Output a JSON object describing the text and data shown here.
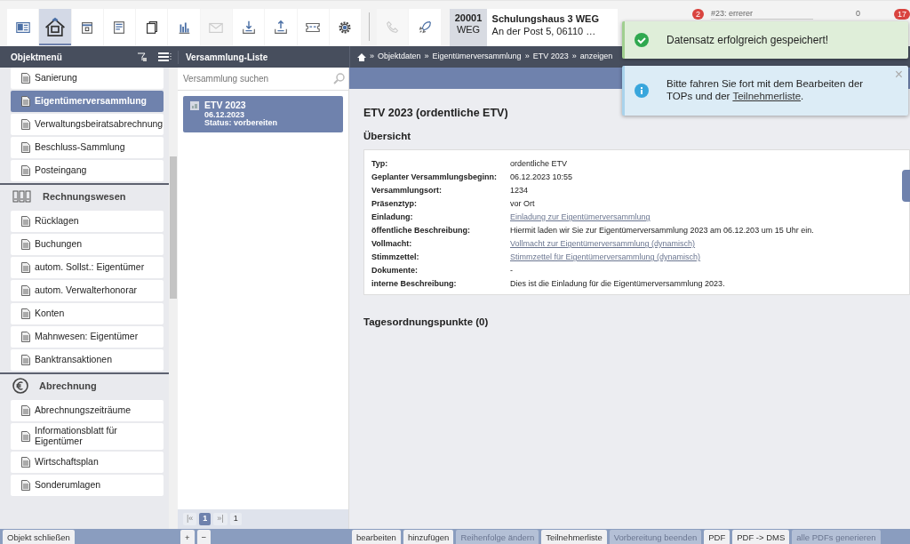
{
  "toolbar": {
    "buttons": [
      {
        "kind": "card",
        "selected": false,
        "disabled": false
      },
      {
        "kind": "house",
        "selected": true,
        "disabled": false
      },
      {
        "kind": "calendar",
        "selected": false,
        "disabled": false
      },
      {
        "kind": "form",
        "selected": false,
        "disabled": false
      },
      {
        "kind": "copies",
        "selected": false,
        "disabled": false
      },
      {
        "kind": "chart",
        "selected": false,
        "disabled": false
      },
      {
        "kind": "envelope",
        "selected": false,
        "disabled": true
      },
      {
        "kind": "download",
        "selected": false,
        "disabled": false
      },
      {
        "kind": "upload",
        "selected": false,
        "disabled": false
      },
      {
        "kind": "ticket",
        "selected": false,
        "disabled": false
      },
      {
        "kind": "gear",
        "selected": false,
        "disabled": false
      },
      {
        "kind": "separator",
        "selected": false,
        "disabled": false
      },
      {
        "kind": "phone",
        "selected": false,
        "disabled": true
      },
      {
        "kind": "rocket",
        "selected": false,
        "disabled": false
      }
    ],
    "object": {
      "number": "20001",
      "type": "WEG",
      "name": "Schulungshaus 3 WEG",
      "address": "An der Post 5, 06110 …"
    },
    "notifications_badge": "2",
    "task": "#23: errerer",
    "timer": "0",
    "messages_badge": "17"
  },
  "toasts": [
    {
      "kind": "success",
      "text": "Datensatz erfolgreich gespeichert!"
    },
    {
      "kind": "info",
      "text": "Bitte fahren Sie fort mit dem Bearbeiten der TOPs und der ",
      "link": "Teilnehmerliste",
      "suffix": ".",
      "close": "×"
    }
  ],
  "sidebar": {
    "title": "Objektmenü",
    "items": [
      {
        "kind": "item",
        "label": "Sanierung",
        "selected": false
      },
      {
        "kind": "item",
        "label": "Eigentümerversammlung",
        "selected": true
      },
      {
        "kind": "item",
        "label": "Verwaltungsbeiratsabrechnung",
        "selected": false
      },
      {
        "kind": "item",
        "label": "Beschluss-Sammlung",
        "selected": false
      },
      {
        "kind": "item",
        "label": "Posteingang",
        "selected": false
      },
      {
        "kind": "section",
        "label": "Rechnungswesen",
        "selected": false
      },
      {
        "kind": "item",
        "label": "Rücklagen",
        "selected": false
      },
      {
        "kind": "item",
        "label": "Buchungen",
        "selected": false
      },
      {
        "kind": "item",
        "label": "autom. Sollst.: Eigentümer",
        "selected": false
      },
      {
        "kind": "item",
        "label": "autom. Verwalterhonorar",
        "selected": false
      },
      {
        "kind": "item",
        "label": "Konten",
        "selected": false
      },
      {
        "kind": "item",
        "label": "Mahnwesen: Eigentümer",
        "selected": false
      },
      {
        "kind": "item",
        "label": "Banktransaktionen",
        "selected": false
      },
      {
        "kind": "section",
        "label": "Abrechnung",
        "selected": false
      },
      {
        "kind": "item",
        "label": "Abrechnungszeiträume",
        "selected": false
      },
      {
        "kind": "item",
        "label": "Informationsblatt für Eigentümer",
        "selected": false
      },
      {
        "kind": "item",
        "label": "Wirtschaftsplan",
        "selected": false
      },
      {
        "kind": "item",
        "label": "Sonderumlagen",
        "selected": false
      }
    ],
    "close_button": "Objekt schließen"
  },
  "list": {
    "title": "Versammlung-Liste",
    "search": {
      "placeholder": "Versammlung suchen"
    },
    "entries": [
      {
        "title": "ETV 2023",
        "date": "06.12.2023",
        "status": "Status: vorbereiten",
        "selected": true
      }
    ],
    "pager": {
      "first": "|«",
      "current": "1",
      "last": "»|",
      "total": "1"
    },
    "add": "+",
    "remove": "−"
  },
  "breadcrumb": [
    {
      "separator": "»",
      "label": "Objektdaten"
    },
    {
      "separator": "»",
      "label": "Eigentümerversammlung"
    },
    {
      "separator": "»",
      "label": "ETV 2023"
    },
    {
      "separator": "»",
      "label": "anzeigen"
    }
  ],
  "content": {
    "title": "ETV 2023 (ordentliche ETV)",
    "subtitle": "Übersicht",
    "rows": [
      {
        "label": "Typ:",
        "value": "ordentliche ETV",
        "kind": "text"
      },
      {
        "label": "Geplanter Versammlungsbeginn:",
        "value": "06.12.2023 10:55",
        "kind": "text"
      },
      {
        "label": "Versammlungsort:",
        "value": "1234",
        "kind": "text"
      },
      {
        "label": "Präsenztyp:",
        "value": "vor Ort",
        "kind": "text"
      },
      {
        "label": "Einladung:",
        "value": "Einladung zur Eigentümerversammlung",
        "kind": "link"
      },
      {
        "label": "öffentliche Beschreibung:",
        "value": "Hiermit laden wir Sie zur Eigentümerversammlung 2023 am 06.12.203 um 15 Uhr ein.",
        "kind": "text"
      },
      {
        "label": "Vollmacht:",
        "value": "Vollmacht zur Eigentümerversammlung (dynamisch)",
        "kind": "link"
      },
      {
        "label": "Stimmzettel:",
        "value": "Stimmzettel für Eigentümerversammlung (dynamisch)",
        "kind": "link"
      },
      {
        "label": "Dokumente:",
        "value": "-",
        "kind": "text"
      },
      {
        "label": "interne Beschreibung:",
        "value": "Dies ist die Einladung für die Eigentümerversammlung 2023.",
        "kind": "text"
      }
    ],
    "agenda": "Tagesordnungspunkte (0)"
  },
  "actions": [
    {
      "label": "bearbeiten",
      "disabled": false
    },
    {
      "label": "hinzufügen",
      "disabled": false
    },
    {
      "label": "Reihenfolge ändern",
      "disabled": true
    },
    {
      "label": "Teilnehmerliste",
      "disabled": false
    },
    {
      "label": "Vorbereitung beenden",
      "disabled": true
    },
    {
      "label": "PDF",
      "disabled": false
    },
    {
      "label": "PDF -> DMS",
      "disabled": false
    },
    {
      "label": "alle PDFs generieren",
      "disabled": true
    }
  ]
}
